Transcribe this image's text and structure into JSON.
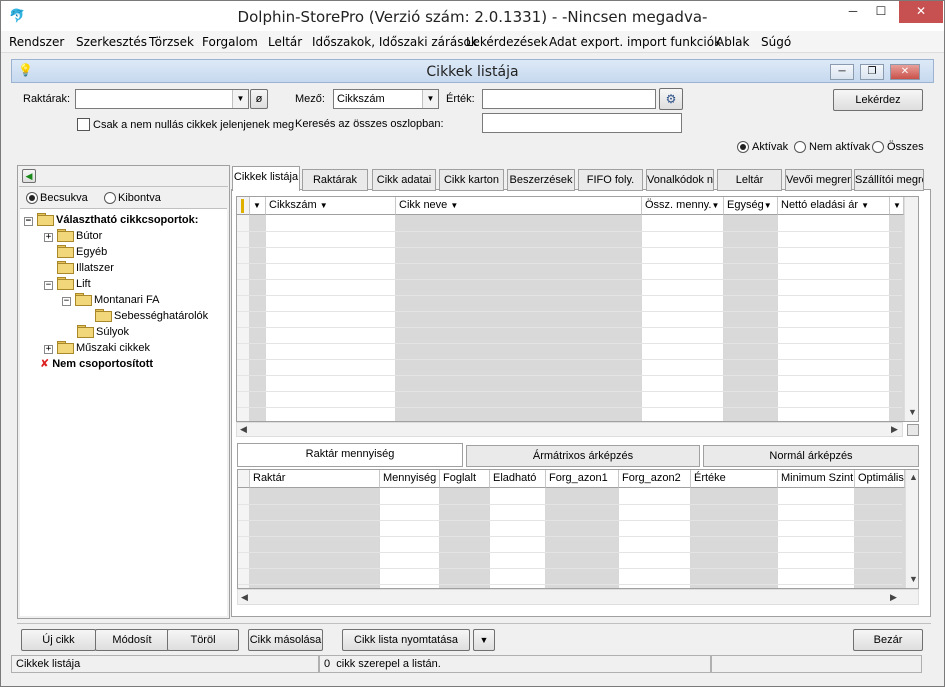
{
  "window": {
    "title": "Dolphin-StorePro  (Verzió szám: 2.0.1331) - -Nincsen megadva-",
    "minimize": "─",
    "maximize": "☐",
    "close": "✕"
  },
  "menu": [
    "Rendszer",
    "Szerkesztés",
    "Törzsek",
    "Forgalom",
    "Leltár",
    "Időszakok, Időszaki zárások",
    "Lekérdezések",
    "Adat export. import funkciók",
    "Ablak",
    "Súgó"
  ],
  "child": {
    "title": "Cikkek listája",
    "minimize": "─",
    "restore": "❐",
    "close": "✕"
  },
  "filter": {
    "raktarak_label": "Raktárak:",
    "raktarak_value": "",
    "clear_btn": "ø",
    "mezo_label": "Mező:",
    "mezo_value": "Cikkszám",
    "ertek_label": "Érték:",
    "ertek_value": "",
    "kereses_label": "Keresés az összes oszlopban:",
    "kereses_value": "",
    "nonzero_label": "Csak a nem nullás cikkek jelenjenek meg",
    "lekerdez_btn": "Lekérdez",
    "status_radios": [
      "Aktívak",
      "Nem aktívak",
      "Összes"
    ],
    "status_selected": "Aktívak"
  },
  "tree": {
    "toggle_arrow": "◀",
    "radios": [
      "Becsukva",
      "Kibontva"
    ],
    "radio_selected": "Becsukva",
    "items": [
      {
        "label": "Választható cikkcsoportok:",
        "bold": true,
        "level": 0,
        "expander": "−"
      },
      {
        "label": "Bútor",
        "level": 1,
        "expander": "+"
      },
      {
        "label": "Egyéb",
        "level": 1,
        "expander": ""
      },
      {
        "label": "Illatszer",
        "level": 1,
        "expander": ""
      },
      {
        "label": "Lift",
        "level": 1,
        "expander": "−"
      },
      {
        "label": "Montanari FA",
        "level": 2,
        "expander": "−"
      },
      {
        "label": "Sebességhatárolók",
        "level": 3,
        "expander": ""
      },
      {
        "label": "Súlyok",
        "level": 2,
        "expander": ""
      },
      {
        "label": "Műszaki cikkek",
        "level": 1,
        "expander": "+"
      },
      {
        "label": "Nem csoportosított",
        "bold": true,
        "level": 0,
        "expander": ""
      }
    ]
  },
  "tabs": [
    "Cikkek listája",
    "Raktárak",
    "Cikk adatai",
    "Cikk karton",
    "Beszerzések",
    "FIFO foly.",
    "Vonalkódok n",
    "Leltár",
    "Vevői megren",
    "Szállítói megre"
  ],
  "active_tab": "Cikkek listája",
  "main_grid": {
    "columns": [
      "Cikkszám",
      "Cikk neve",
      "Össz. menny.",
      "Egység",
      "Nettó eladási ár"
    ],
    "sort_glyph": "▼"
  },
  "subtabs": [
    "Raktár mennyiség",
    "Ármátrixos árképzés",
    "Normál árképzés"
  ],
  "active_subtab": "Raktár mennyiség",
  "sub_grid": {
    "columns": [
      "Raktár",
      "Mennyiség",
      "Foglalt",
      "Eladható",
      "Forg_azon1",
      "Forg_azon2",
      "Értéke",
      "Minimum Szint",
      "Optimális"
    ]
  },
  "buttons": {
    "uj": "Új cikk",
    "modosit": "Módosít",
    "torol": "Töröl",
    "masolasa": "Cikk másolása",
    "nyomtatasa": "Cikk lista nyomtatása",
    "nyomtatasa_dd": "▼",
    "bezar": "Bezár"
  },
  "status": {
    "left": "Cikkek listája",
    "count": "0",
    "message": "cikk szerepel a listán."
  }
}
